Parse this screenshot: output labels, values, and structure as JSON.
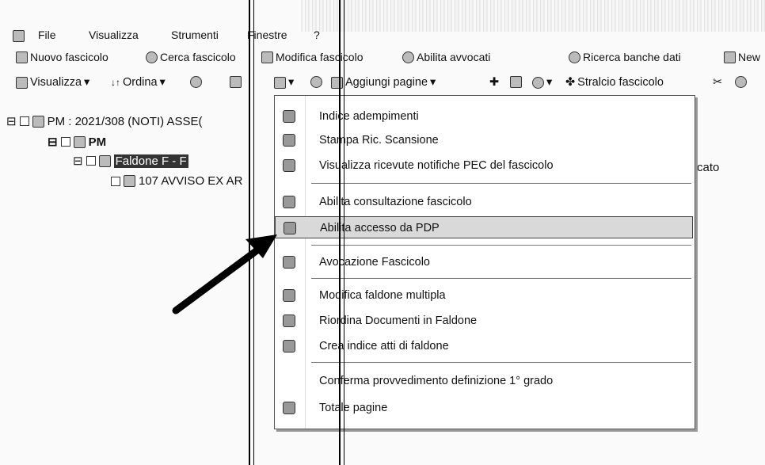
{
  "menubar": {
    "items": [
      "File",
      "Visualizza",
      "Strumenti",
      "Finestre",
      "?"
    ]
  },
  "toolbar1": {
    "items": [
      "Nuovo fascicolo",
      "Cerca fascicolo",
      "Modifica fascicolo",
      "Abilita avvocati",
      "Ricerca banche dati",
      "New"
    ]
  },
  "toolbar2": {
    "visualizza": "Visualizza",
    "ordina": "Ordina",
    "aggiungi": "Aggiungi pagine",
    "stralcio": "Stralcio fascicolo"
  },
  "tree": {
    "root": "PM : 2021/308 (NOTI) ASSE(",
    "pm": "PM",
    "faldone": "Faldone F - F",
    "doc": "107 AVVISO EX AR",
    "side_text": "cato"
  },
  "context_menu": {
    "items": [
      {
        "label": "Indice adempimenti",
        "icon": "edit-icon"
      },
      {
        "label": "Stampa Ric. Scansione",
        "icon": "barcode-icon"
      },
      {
        "label": "Visualizza ricevute notifiche PEC del fascicolo",
        "icon": "mail-receipt-icon"
      },
      {
        "label": "Abilita consultazione fascicolo",
        "icon": "key-icon"
      },
      {
        "label": "Abilita accesso da PDP",
        "icon": "key-icon",
        "highlighted": true
      },
      {
        "label": "Avocazione Fascicolo",
        "icon": "transfer-icon"
      },
      {
        "label": "Modifica faldone multipla",
        "icon": "edit-icon"
      },
      {
        "label": "Riordina Documenti in Faldone",
        "icon": "reorder-icon"
      },
      {
        "label": "Crea indice atti di faldone",
        "icon": "index-icon"
      },
      {
        "label": "Conferma provvedimento definizione 1° grado",
        "icon": ""
      },
      {
        "label": "Totale pagine",
        "icon": "pages-icon"
      }
    ]
  }
}
